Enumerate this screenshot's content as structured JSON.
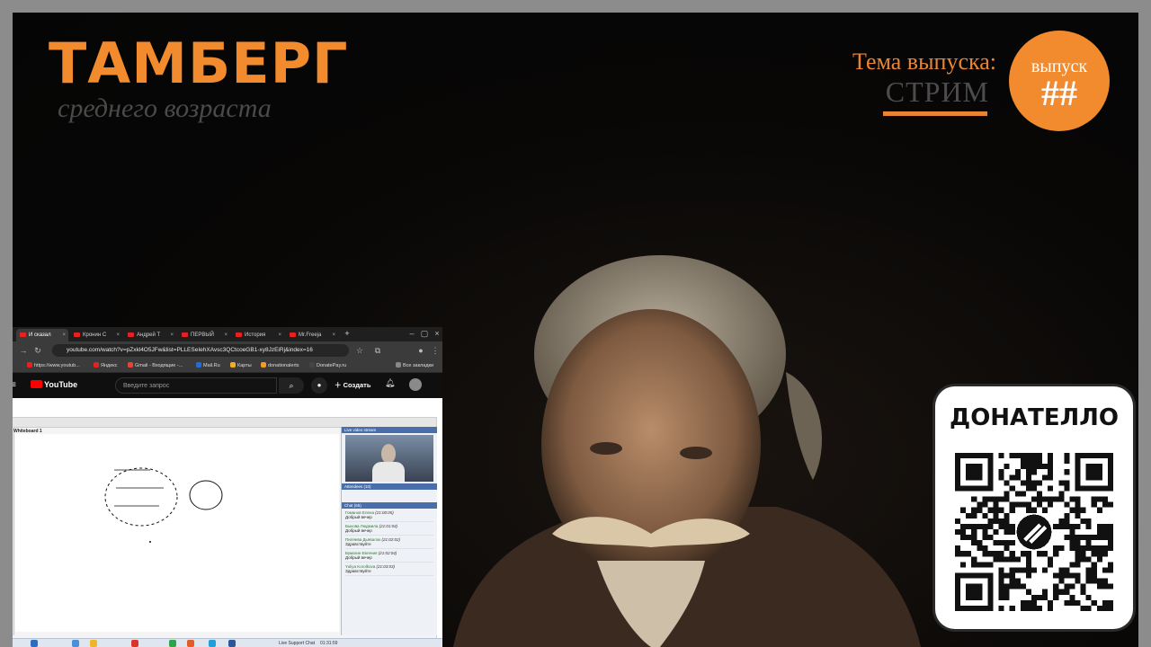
{
  "overlay": {
    "brand_title": "ТАМБЕРГ",
    "brand_subtitle": "среднего возраста",
    "topic_label": "Тема выпуска:",
    "topic_value": "СТРИМ",
    "issue_label": "выпуск",
    "issue_number": "##",
    "donate_title": "ДОНАТЕЛЛО",
    "accent_color": "#f28a2e"
  },
  "browser": {
    "tabs": [
      {
        "label": "И сказал",
        "active": true
      },
      {
        "label": "Кронин С",
        "active": false
      },
      {
        "label": "Андрей Т",
        "active": false
      },
      {
        "label": "ПЕРВЫЙ",
        "active": false
      },
      {
        "label": "История",
        "active": false
      },
      {
        "label": "Mr.Freeja",
        "active": false
      }
    ],
    "url": "youtube.com/watch?v=pZxkl4O5JFw&list=PLLESeIehXAvsc3QCtcoeGB1-xy8JzEiRj&index=16",
    "bookmarks": [
      {
        "label": "https://www.youtub...",
        "color": "#e52222"
      },
      {
        "label": "Яндекс",
        "color": "#e52222"
      },
      {
        "label": "Gmail - Входящие -...",
        "color": "#ea4335"
      },
      {
        "label": "Mail.Ru",
        "color": "#1e6fd9"
      },
      {
        "label": "Карты",
        "color": "#f2b01e"
      },
      {
        "label": "donationalerts",
        "color": "#f59a23"
      },
      {
        "label": "DonatePay.ru",
        "color": "#444444"
      }
    ],
    "bookmarks_all": "Все закладки",
    "youtube": {
      "logo": "YouTube",
      "search_placeholder": "Введите запрос",
      "create_label": "Создать"
    },
    "lesson": {
      "whiteboard_title": "Whiteboard 1",
      "panel_header": "Live video stream",
      "attendees": "Attendees (10)",
      "chat_header": "Chat (65)",
      "chat": [
        {
          "name": "Гоманов Елена",
          "time": "(21:00:05)",
          "text": "Добрый вечер"
        },
        {
          "name": "Быкова Людмила",
          "time": "(21:01:04)",
          "text": "Добрый вечер"
        },
        {
          "name": "Пиляева Дьявалок",
          "time": "(21:02:02)",
          "text": "Здравствуйте"
        },
        {
          "name": "Бумагин Евгения",
          "time": "(21:02:04)",
          "text": "Добрый вечер"
        },
        {
          "name": "Yuliya Korolkova",
          "time": "(21:03:03)",
          "text": "Здравствуйте"
        }
      ],
      "taskbar_chat": "Live Support Chat",
      "elapsed": "01:31:59"
    }
  }
}
